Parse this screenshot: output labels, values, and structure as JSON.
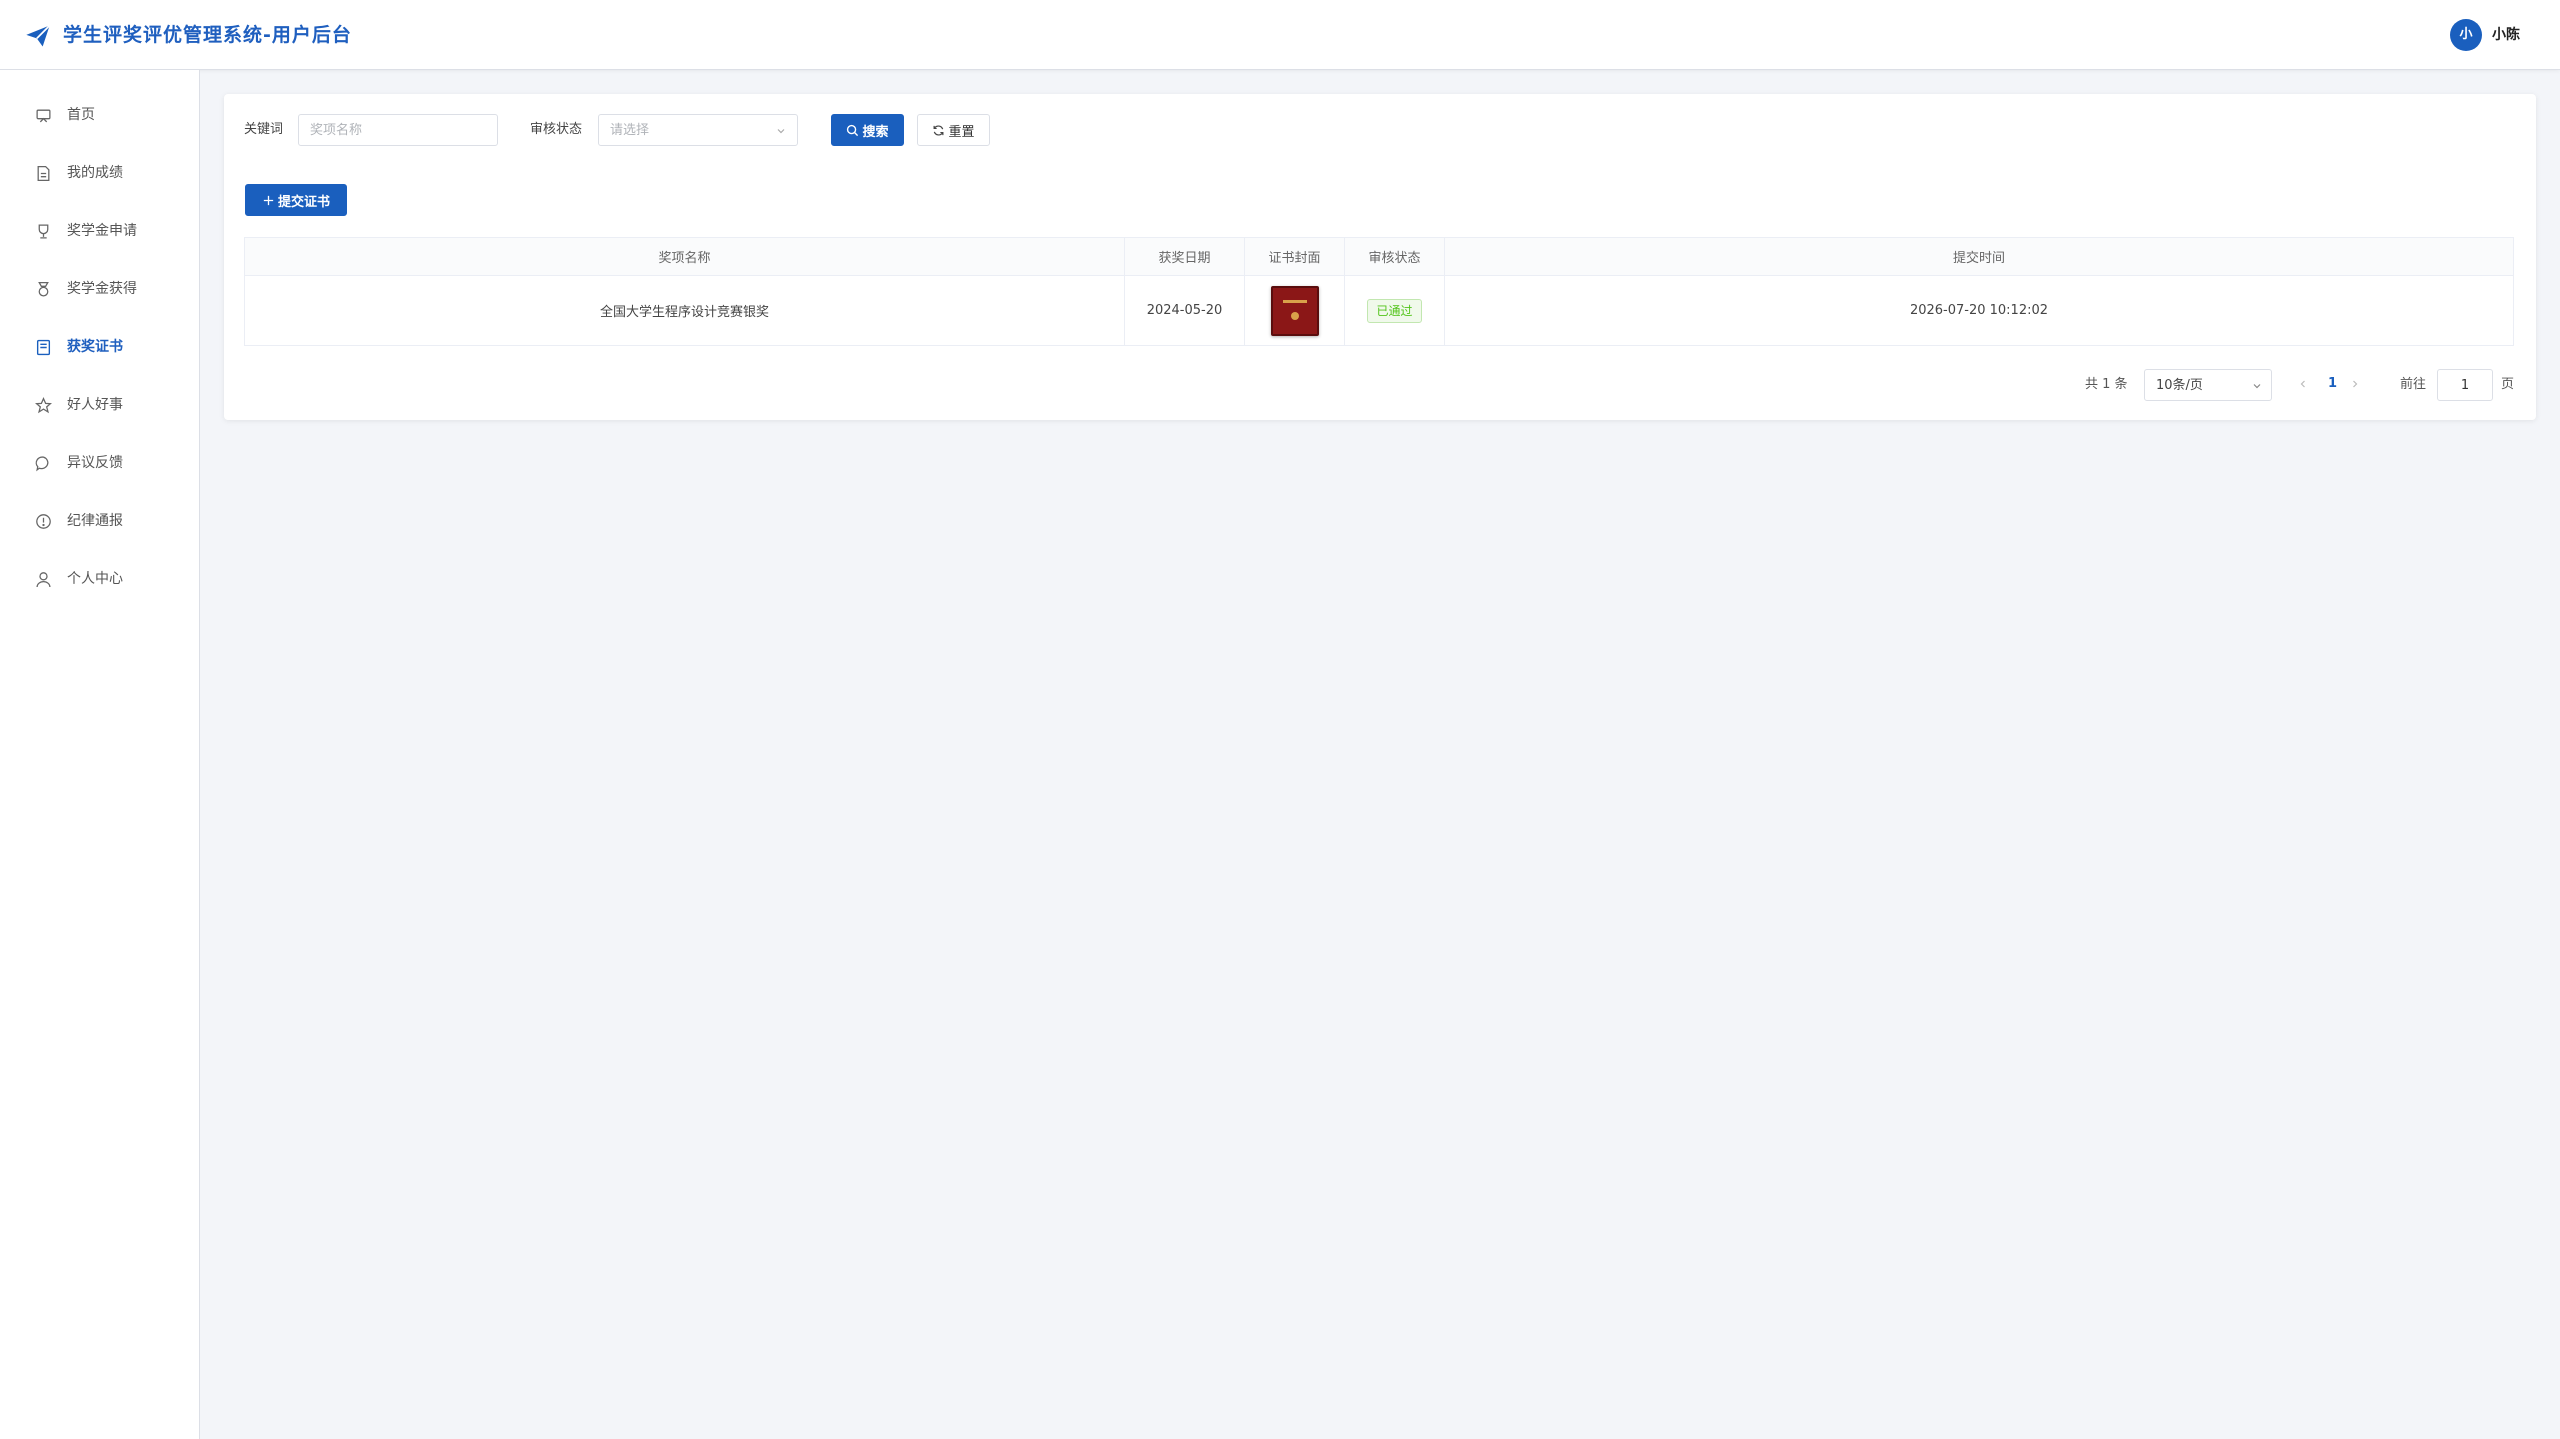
{
  "header": {
    "title": "学生评奖评优管理系统-用户后台",
    "avatar_text": "小",
    "username": "小陈"
  },
  "sidebar": {
    "items": [
      {
        "label": "首页",
        "icon": "home-icon"
      },
      {
        "label": "我的成绩",
        "icon": "document-icon"
      },
      {
        "label": "奖学金申请",
        "icon": "trophy-icon"
      },
      {
        "label": "奖学金获得",
        "icon": "medal-icon"
      },
      {
        "label": "获奖证书",
        "icon": "certificate-icon",
        "active": true
      },
      {
        "label": "好人好事",
        "icon": "star-icon"
      },
      {
        "label": "异议反馈",
        "icon": "chat-icon"
      },
      {
        "label": "纪律通报",
        "icon": "warning-icon"
      },
      {
        "label": "个人中心",
        "icon": "user-icon"
      }
    ]
  },
  "search": {
    "keyword_label": "关键词",
    "keyword_placeholder": "奖项名称",
    "status_label": "审核状态",
    "status_placeholder": "请选择",
    "search_button": "搜索",
    "reset_button": "重置"
  },
  "actions": {
    "submit_button": "提交证书"
  },
  "table": {
    "columns": [
      "奖项名称",
      "获奖日期",
      "证书封面",
      "审核状态",
      "提交时间"
    ],
    "rows": [
      {
        "award_name": "全国大学生程序设计竞赛银奖",
        "award_date": "2024-05-20",
        "cover": "certificate-thumbnail",
        "status": "已通过",
        "submit_time": "2026-07-20 10:12:02"
      }
    ]
  },
  "pagination": {
    "total_text": "共 1 条",
    "page_size": "10条/页",
    "current_page": "1",
    "goto_label": "前往",
    "goto_value": "1",
    "page_suffix": "页"
  },
  "colors": {
    "primary": "#1a5fbe",
    "success": "#52c41a",
    "background": "#f3f5f9"
  }
}
